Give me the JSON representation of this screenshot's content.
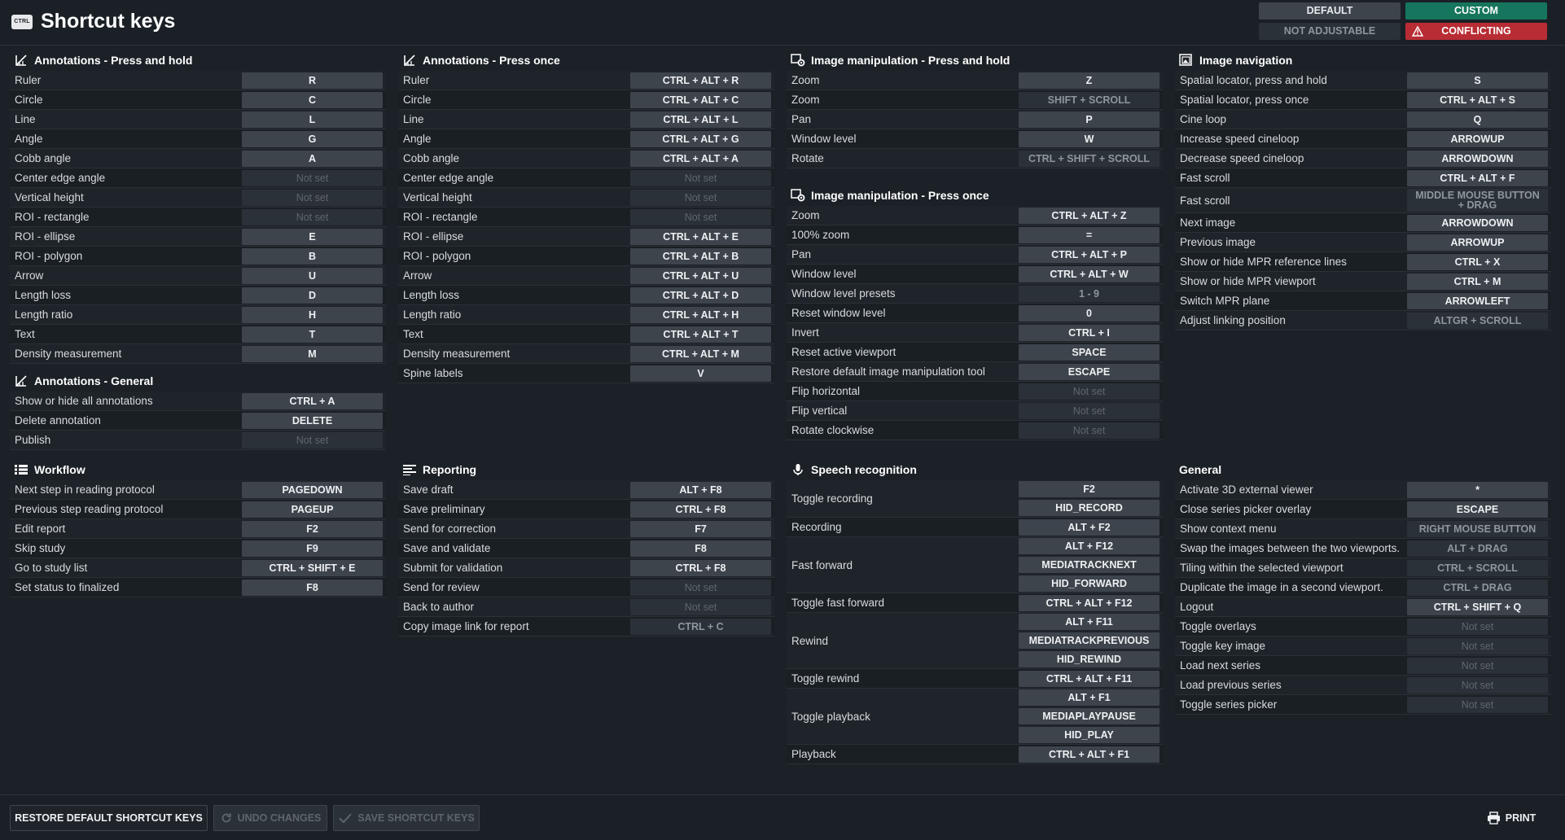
{
  "header": {
    "icon_text": "CTRL",
    "title": "Shortcut keys",
    "legend": {
      "default": "DEFAULT",
      "custom": "CUSTOM",
      "not_adjustable": "NOT ADJUSTABLE",
      "conflicting": "CONFLICTING"
    }
  },
  "colors": {
    "custom": "#16765d",
    "conflicting": "#b82c33",
    "default_key": "#3d444c",
    "not_adjustable": "#2b3138"
  },
  "sections": [
    {
      "id": "ann-hold",
      "icon": "annotation-icon",
      "title": "Annotations - Press and hold",
      "rows": [
        {
          "label": "Ruler",
          "keys": [
            {
              "text": "R"
            }
          ]
        },
        {
          "label": "Circle",
          "keys": [
            {
              "text": "C"
            }
          ]
        },
        {
          "label": "Line",
          "keys": [
            {
              "text": "L"
            }
          ]
        },
        {
          "label": "Angle",
          "keys": [
            {
              "text": "G"
            }
          ]
        },
        {
          "label": "Cobb angle",
          "keys": [
            {
              "text": "A"
            }
          ]
        },
        {
          "label": "Center edge angle",
          "keys": [
            {
              "text": "Not set",
              "state": "notset"
            }
          ]
        },
        {
          "label": "Vertical height",
          "keys": [
            {
              "text": "Not set",
              "state": "notset"
            }
          ]
        },
        {
          "label": "ROI - rectangle",
          "keys": [
            {
              "text": "Not set",
              "state": "notset"
            }
          ]
        },
        {
          "label": "ROI - ellipse",
          "keys": [
            {
              "text": "E"
            }
          ]
        },
        {
          "label": "ROI - polygon",
          "keys": [
            {
              "text": "B"
            }
          ]
        },
        {
          "label": "Arrow",
          "keys": [
            {
              "text": "U"
            }
          ]
        },
        {
          "label": "Length loss",
          "keys": [
            {
              "text": "D"
            }
          ]
        },
        {
          "label": "Length ratio",
          "keys": [
            {
              "text": "H"
            }
          ]
        },
        {
          "label": "Text",
          "keys": [
            {
              "text": "T"
            }
          ]
        },
        {
          "label": "Density measurement",
          "keys": [
            {
              "text": "M"
            }
          ]
        }
      ]
    },
    {
      "id": "ann-general",
      "icon": "annotation-icon",
      "title": "Annotations - General",
      "rows": [
        {
          "label": "Show or hide all annotations",
          "keys": [
            {
              "text": "CTRL + A"
            }
          ]
        },
        {
          "label": "Delete annotation",
          "keys": [
            {
              "text": "DELETE"
            }
          ]
        },
        {
          "label": "Publish",
          "keys": [
            {
              "text": "Not set",
              "state": "notset"
            }
          ]
        }
      ]
    },
    {
      "id": "workflow",
      "icon": "list-icon",
      "title": "Workflow",
      "rows": [
        {
          "label": "Next step in reading protocol",
          "keys": [
            {
              "text": "PAGEDOWN"
            }
          ]
        },
        {
          "label": "Previous step reading protocol",
          "keys": [
            {
              "text": "PAGEUP"
            }
          ]
        },
        {
          "label": "Edit report",
          "keys": [
            {
              "text": "F2"
            }
          ]
        },
        {
          "label": "Skip study",
          "keys": [
            {
              "text": "F9"
            }
          ]
        },
        {
          "label": "Go to study list",
          "keys": [
            {
              "text": "CTRL + SHIFT + E"
            }
          ]
        },
        {
          "label": "Set status to finalized",
          "keys": [
            {
              "text": "F8"
            }
          ]
        }
      ]
    },
    {
      "id": "ann-once",
      "icon": "annotation-icon",
      "title": "Annotations - Press once",
      "rows": [
        {
          "label": "Ruler",
          "keys": [
            {
              "text": "CTRL + ALT + R"
            }
          ]
        },
        {
          "label": "Circle",
          "keys": [
            {
              "text": "CTRL + ALT + C"
            }
          ]
        },
        {
          "label": "Line",
          "keys": [
            {
              "text": "CTRL + ALT + L"
            }
          ]
        },
        {
          "label": "Angle",
          "keys": [
            {
              "text": "CTRL + ALT + G"
            }
          ]
        },
        {
          "label": "Cobb angle",
          "keys": [
            {
              "text": "CTRL + ALT + A"
            }
          ]
        },
        {
          "label": "Center edge angle",
          "keys": [
            {
              "text": "Not set",
              "state": "notset"
            }
          ]
        },
        {
          "label": "Vertical height",
          "keys": [
            {
              "text": "Not set",
              "state": "notset"
            }
          ]
        },
        {
          "label": "ROI - rectangle",
          "keys": [
            {
              "text": "Not set",
              "state": "notset"
            }
          ]
        },
        {
          "label": "ROI - ellipse",
          "keys": [
            {
              "text": "CTRL + ALT + E"
            }
          ]
        },
        {
          "label": "ROI - polygon",
          "keys": [
            {
              "text": "CTRL + ALT + B"
            }
          ]
        },
        {
          "label": "Arrow",
          "keys": [
            {
              "text": "CTRL + ALT + U"
            }
          ]
        },
        {
          "label": "Length loss",
          "keys": [
            {
              "text": "CTRL + ALT + D"
            }
          ]
        },
        {
          "label": "Length ratio",
          "keys": [
            {
              "text": "CTRL + ALT + H"
            }
          ]
        },
        {
          "label": "Text",
          "keys": [
            {
              "text": "CTRL + ALT + T"
            }
          ]
        },
        {
          "label": "Density measurement",
          "keys": [
            {
              "text": "CTRL + ALT + M"
            }
          ]
        },
        {
          "label": "Spine labels",
          "keys": [
            {
              "text": "V"
            }
          ]
        }
      ]
    },
    {
      "id": "reporting",
      "icon": "report-icon",
      "title": "Reporting",
      "rows": [
        {
          "label": "Save draft",
          "keys": [
            {
              "text": "ALT + F8"
            }
          ]
        },
        {
          "label": "Save preliminary",
          "keys": [
            {
              "text": "CTRL + F8"
            }
          ]
        },
        {
          "label": "Send for correction",
          "keys": [
            {
              "text": "F7"
            }
          ]
        },
        {
          "label": "Save and validate",
          "keys": [
            {
              "text": "F8"
            }
          ]
        },
        {
          "label": "Submit for validation",
          "keys": [
            {
              "text": "CTRL + F8"
            }
          ]
        },
        {
          "label": "Send for review",
          "keys": [
            {
              "text": "Not set",
              "state": "notset"
            }
          ]
        },
        {
          "label": "Back to author",
          "keys": [
            {
              "text": "Not set",
              "state": "notset"
            }
          ]
        },
        {
          "label": "Copy image link for report",
          "keys": [
            {
              "text": "CTRL + C",
              "state": "na"
            }
          ]
        }
      ]
    },
    {
      "id": "img-hold",
      "icon": "image-settings-icon",
      "title": "Image manipulation - Press and hold",
      "rows": [
        {
          "label": "Zoom",
          "keys": [
            {
              "text": "Z"
            }
          ]
        },
        {
          "label": "Zoom",
          "keys": [
            {
              "text": "SHIFT + SCROLL",
              "state": "na"
            }
          ]
        },
        {
          "label": "Pan",
          "keys": [
            {
              "text": "P"
            }
          ]
        },
        {
          "label": "Window level",
          "keys": [
            {
              "text": "W"
            }
          ]
        },
        {
          "label": "Rotate",
          "keys": [
            {
              "text": "CTRL + SHIFT + SCROLL",
              "state": "na"
            }
          ]
        }
      ]
    },
    {
      "id": "img-once",
      "icon": "image-settings-icon",
      "title": "Image manipulation - Press once",
      "rows": [
        {
          "label": "Zoom",
          "keys": [
            {
              "text": "CTRL + ALT + Z"
            }
          ]
        },
        {
          "label": "100% zoom",
          "keys": [
            {
              "text": "="
            }
          ]
        },
        {
          "label": "Pan",
          "keys": [
            {
              "text": "CTRL + ALT + P"
            }
          ]
        },
        {
          "label": "Window level",
          "keys": [
            {
              "text": "CTRL + ALT + W"
            }
          ]
        },
        {
          "label": "Window level presets",
          "keys": [
            {
              "text": "1 - 9",
              "state": "na"
            }
          ]
        },
        {
          "label": "Reset window level",
          "keys": [
            {
              "text": "0"
            }
          ]
        },
        {
          "label": "Invert",
          "keys": [
            {
              "text": "CTRL + I"
            }
          ]
        },
        {
          "label": "Reset active viewport",
          "keys": [
            {
              "text": "SPACE"
            }
          ]
        },
        {
          "label": "Restore default image manipulation tool",
          "keys": [
            {
              "text": "ESCAPE"
            }
          ]
        },
        {
          "label": "Flip horizontal",
          "keys": [
            {
              "text": "Not set",
              "state": "notset"
            }
          ]
        },
        {
          "label": "Flip vertical",
          "keys": [
            {
              "text": "Not set",
              "state": "notset"
            }
          ]
        },
        {
          "label": "Rotate clockwise",
          "keys": [
            {
              "text": "Not set",
              "state": "notset"
            }
          ]
        }
      ]
    },
    {
      "id": "speech",
      "icon": "microphone-icon",
      "title": "Speech recognition",
      "rows": [
        {
          "label": "Toggle recording",
          "keys": [
            {
              "text": "F2"
            },
            {
              "text": "HID_RECORD"
            }
          ]
        },
        {
          "label": "Recording",
          "keys": [
            {
              "text": "ALT + F2"
            }
          ]
        },
        {
          "label": "Fast forward",
          "keys": [
            {
              "text": "ALT + F12"
            },
            {
              "text": "MEDIATRACKNEXT"
            },
            {
              "text": "HID_FORWARD"
            }
          ]
        },
        {
          "label": "Toggle fast forward",
          "keys": [
            {
              "text": "CTRL + ALT + F12"
            }
          ]
        },
        {
          "label": "Rewind",
          "keys": [
            {
              "text": "ALT + F11"
            },
            {
              "text": "MEDIATRACKPREVIOUS"
            },
            {
              "text": "HID_REWIND"
            }
          ]
        },
        {
          "label": "Toggle rewind",
          "keys": [
            {
              "text": "CTRL + ALT + F11"
            }
          ]
        },
        {
          "label": "Toggle playback",
          "keys": [
            {
              "text": "ALT + F1"
            },
            {
              "text": "MEDIAPLAYPAUSE"
            },
            {
              "text": "HID_PLAY"
            }
          ]
        },
        {
          "label": "Playback",
          "keys": [
            {
              "text": "CTRL + ALT + F1"
            }
          ]
        }
      ]
    },
    {
      "id": "img-nav",
      "icon": "image-navigation-icon",
      "title": "Image navigation",
      "rows": [
        {
          "label": "Spatial locator, press and hold",
          "keys": [
            {
              "text": "S"
            }
          ]
        },
        {
          "label": "Spatial locator, press once",
          "keys": [
            {
              "text": "CTRL + ALT + S"
            }
          ]
        },
        {
          "label": "Cine loop",
          "keys": [
            {
              "text": "Q"
            }
          ]
        },
        {
          "label": "Increase speed cineloop",
          "keys": [
            {
              "text": "ARROWUP"
            }
          ]
        },
        {
          "label": "Decrease speed cineloop",
          "keys": [
            {
              "text": "ARROWDOWN"
            }
          ]
        },
        {
          "label": "Fast scroll",
          "keys": [
            {
              "text": "CTRL + ALT + F"
            }
          ]
        },
        {
          "label": "Fast scroll",
          "keys": [
            {
              "text": "MIDDLE MOUSE BUTTON + DRAG",
              "state": "na"
            }
          ]
        },
        {
          "label": "Next image",
          "keys": [
            {
              "text": "ARROWDOWN"
            }
          ]
        },
        {
          "label": "Previous image",
          "keys": [
            {
              "text": "ARROWUP"
            }
          ]
        },
        {
          "label": "Show or hide MPR reference lines",
          "keys": [
            {
              "text": "CTRL + X"
            }
          ]
        },
        {
          "label": "Show or hide MPR viewport",
          "keys": [
            {
              "text": "CTRL + M"
            }
          ]
        },
        {
          "label": "Switch MPR plane",
          "keys": [
            {
              "text": "ARROWLEFT"
            }
          ]
        },
        {
          "label": "Adjust linking position",
          "keys": [
            {
              "text": "ALTGR + SCROLL",
              "state": "na"
            }
          ]
        }
      ]
    },
    {
      "id": "general",
      "icon": "",
      "title": "General",
      "rows": [
        {
          "label": "Activate 3D external viewer",
          "keys": [
            {
              "text": "*"
            }
          ]
        },
        {
          "label": "Close series picker overlay",
          "keys": [
            {
              "text": "ESCAPE"
            }
          ]
        },
        {
          "label": "Show context menu",
          "keys": [
            {
              "text": "RIGHT MOUSE BUTTON",
              "state": "na"
            }
          ]
        },
        {
          "label": "Swap the images between the two viewports.",
          "keys": [
            {
              "text": "ALT + DRAG",
              "state": "na"
            }
          ]
        },
        {
          "label": "Tiling within the selected viewport",
          "keys": [
            {
              "text": "CTRL + SCROLL",
              "state": "na"
            }
          ]
        },
        {
          "label": "Duplicate the image in a second viewport.",
          "keys": [
            {
              "text": "CTRL + DRAG",
              "state": "na"
            }
          ]
        },
        {
          "label": "Logout",
          "keys": [
            {
              "text": "CTRL + SHIFT + Q"
            }
          ]
        },
        {
          "label": "Toggle overlays",
          "keys": [
            {
              "text": "Not set",
              "state": "notset"
            }
          ]
        },
        {
          "label": "Toggle key image",
          "keys": [
            {
              "text": "Not set",
              "state": "notset"
            }
          ]
        },
        {
          "label": "Load next series",
          "keys": [
            {
              "text": "Not set",
              "state": "notset"
            }
          ]
        },
        {
          "label": "Load previous series",
          "keys": [
            {
              "text": "Not set",
              "state": "notset"
            }
          ]
        },
        {
          "label": "Toggle series picker",
          "keys": [
            {
              "text": "Not set",
              "state": "notset"
            }
          ]
        }
      ]
    }
  ],
  "footer": {
    "restore": "RESTORE DEFAULT SHORTCUT KEYS",
    "undo": "UNDO CHANGES",
    "save": "SAVE SHORTCUT KEYS",
    "print": "PRINT"
  }
}
